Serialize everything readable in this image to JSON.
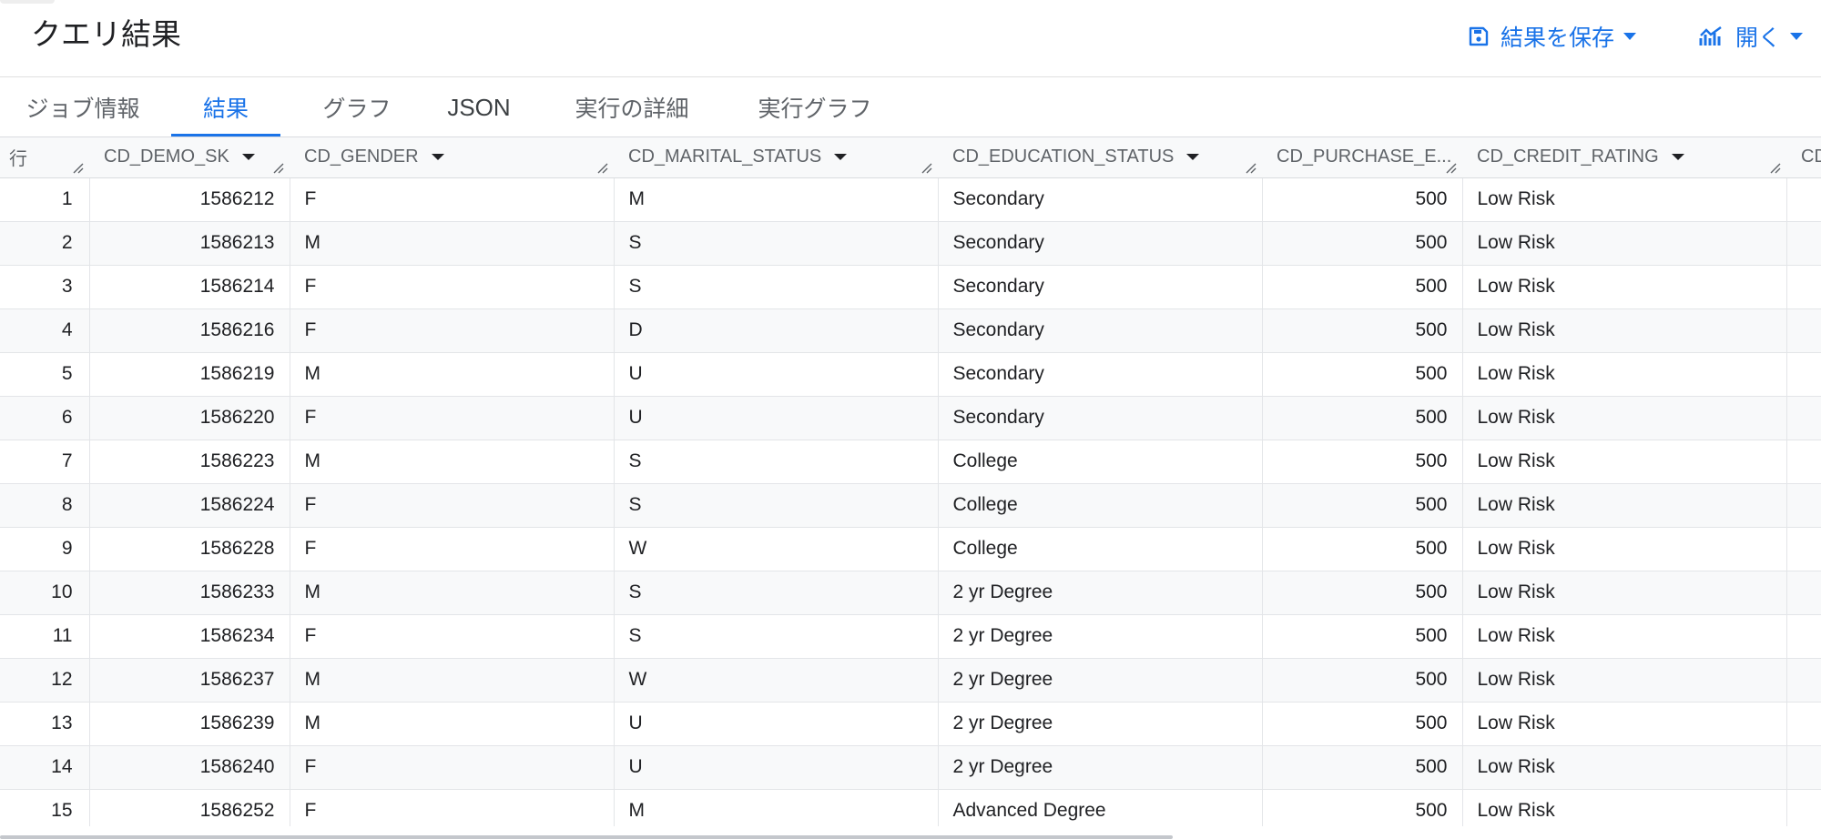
{
  "header": {
    "title": "クエリ結果",
    "save_label": "結果を保存",
    "open_label": "開く",
    "accent_color": "#1a73e8"
  },
  "tabs": [
    {
      "label": "ジョブ情報",
      "active": false
    },
    {
      "label": "結果",
      "active": true
    },
    {
      "label": "グラフ",
      "active": false
    },
    {
      "label": "JSON",
      "active": false
    },
    {
      "label": "実行の詳細",
      "active": false
    },
    {
      "label": "実行グラフ",
      "active": false
    }
  ],
  "table": {
    "row_header": "行",
    "columns": [
      "CD_DEMO_SK",
      "CD_GENDER",
      "CD_MARITAL_STATUS",
      "CD_EDUCATION_STATUS",
      "CD_PURCHASE_E...",
      "CD_CREDIT_RATING",
      "CD"
    ],
    "rows": [
      {
        "n": "1",
        "sk": "1586212",
        "gender": "F",
        "marital": "M",
        "edu": "Secondary",
        "purchase": "500",
        "credit": "Low Risk"
      },
      {
        "n": "2",
        "sk": "1586213",
        "gender": "M",
        "marital": "S",
        "edu": "Secondary",
        "purchase": "500",
        "credit": "Low Risk"
      },
      {
        "n": "3",
        "sk": "1586214",
        "gender": "F",
        "marital": "S",
        "edu": "Secondary",
        "purchase": "500",
        "credit": "Low Risk"
      },
      {
        "n": "4",
        "sk": "1586216",
        "gender": "F",
        "marital": "D",
        "edu": "Secondary",
        "purchase": "500",
        "credit": "Low Risk"
      },
      {
        "n": "5",
        "sk": "1586219",
        "gender": "M",
        "marital": "U",
        "edu": "Secondary",
        "purchase": "500",
        "credit": "Low Risk"
      },
      {
        "n": "6",
        "sk": "1586220",
        "gender": "F",
        "marital": "U",
        "edu": "Secondary",
        "purchase": "500",
        "credit": "Low Risk"
      },
      {
        "n": "7",
        "sk": "1586223",
        "gender": "M",
        "marital": "S",
        "edu": "College",
        "purchase": "500",
        "credit": "Low Risk"
      },
      {
        "n": "8",
        "sk": "1586224",
        "gender": "F",
        "marital": "S",
        "edu": "College",
        "purchase": "500",
        "credit": "Low Risk"
      },
      {
        "n": "9",
        "sk": "1586228",
        "gender": "F",
        "marital": "W",
        "edu": "College",
        "purchase": "500",
        "credit": "Low Risk"
      },
      {
        "n": "10",
        "sk": "1586233",
        "gender": "M",
        "marital": "S",
        "edu": "2 yr Degree",
        "purchase": "500",
        "credit": "Low Risk"
      },
      {
        "n": "11",
        "sk": "1586234",
        "gender": "F",
        "marital": "S",
        "edu": "2 yr Degree",
        "purchase": "500",
        "credit": "Low Risk"
      },
      {
        "n": "12",
        "sk": "1586237",
        "gender": "M",
        "marital": "W",
        "edu": "2 yr Degree",
        "purchase": "500",
        "credit": "Low Risk"
      },
      {
        "n": "13",
        "sk": "1586239",
        "gender": "M",
        "marital": "U",
        "edu": "2 yr Degree",
        "purchase": "500",
        "credit": "Low Risk"
      },
      {
        "n": "14",
        "sk": "1586240",
        "gender": "F",
        "marital": "U",
        "edu": "2 yr Degree",
        "purchase": "500",
        "credit": "Low Risk"
      },
      {
        "n": "15",
        "sk": "1586252",
        "gender": "F",
        "marital": "M",
        "edu": "Advanced Degree",
        "purchase": "500",
        "credit": "Low Risk"
      }
    ]
  }
}
